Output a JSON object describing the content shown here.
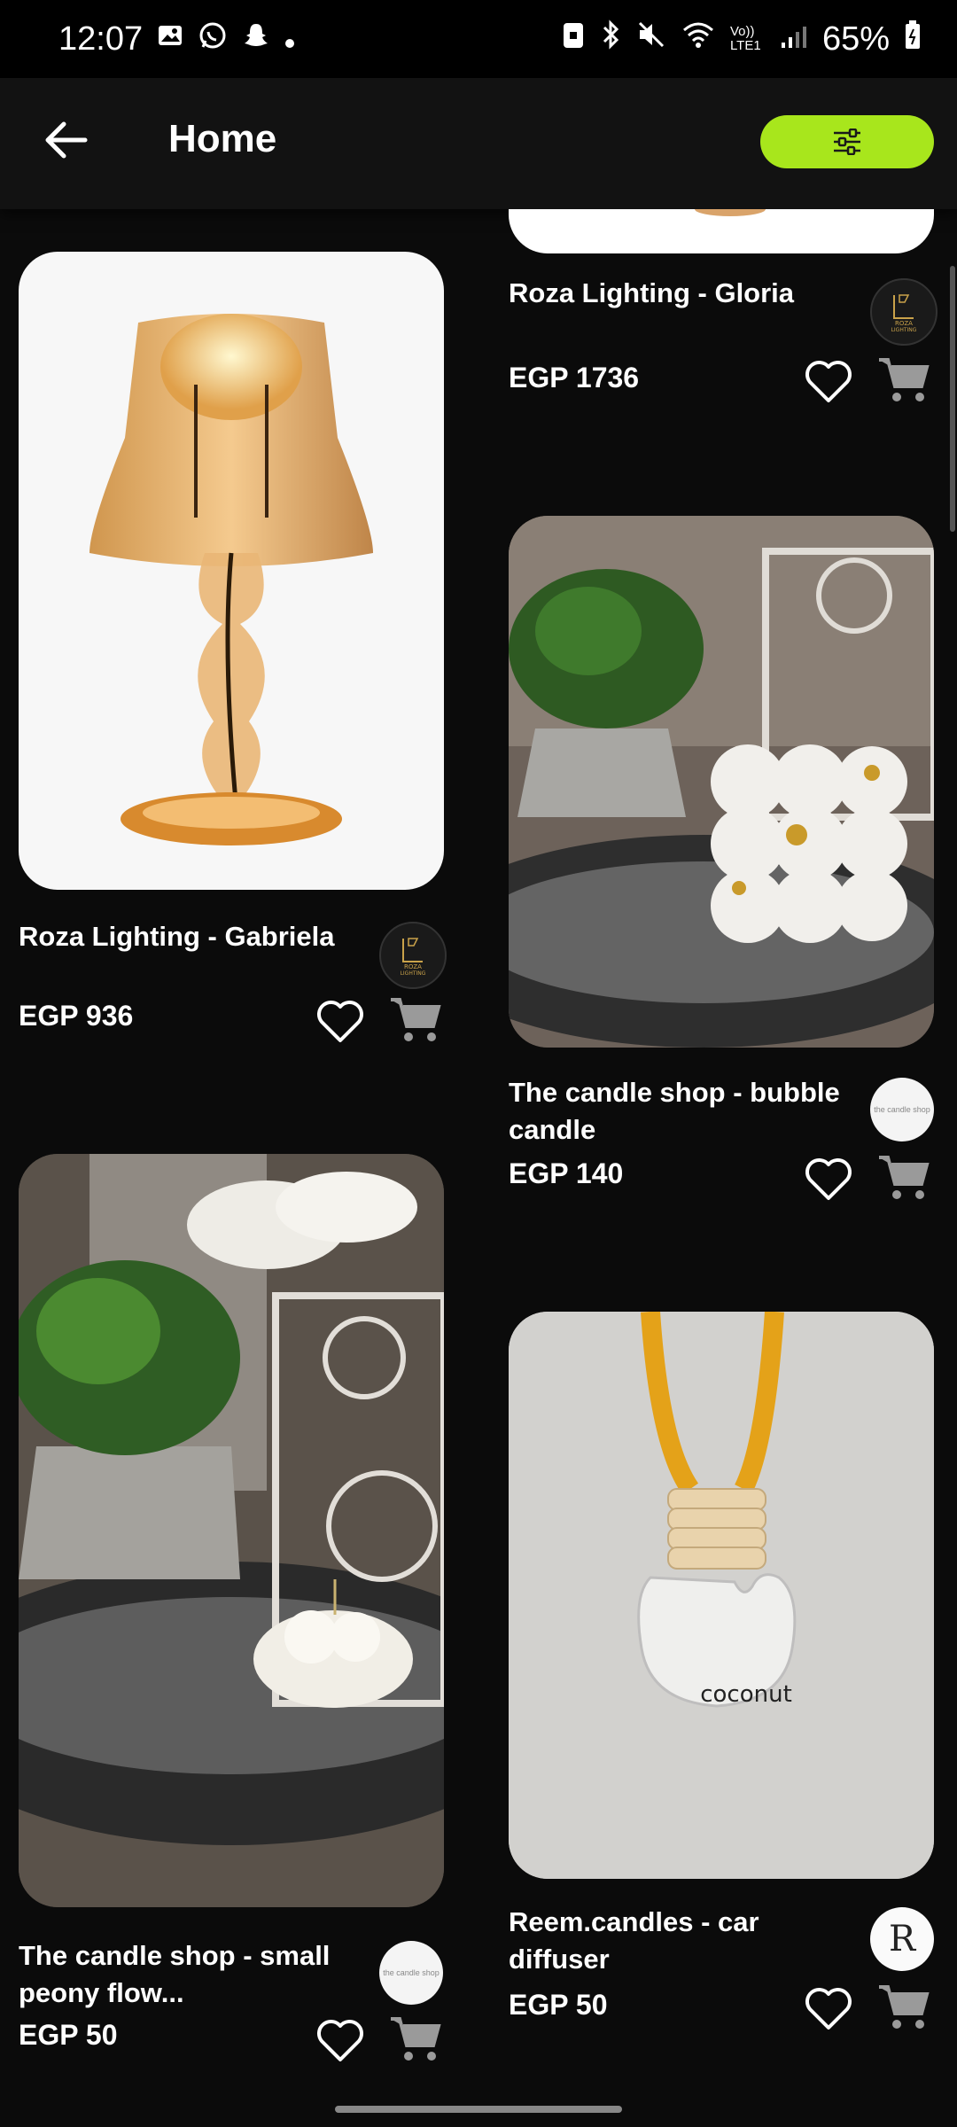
{
  "status": {
    "time": "12:07",
    "battery": "65%",
    "left_icons": [
      "gallery-icon",
      "whatsapp-icon",
      "snapchat-icon",
      "dot-icon"
    ],
    "right_icons": [
      "lock-battery-icon",
      "bluetooth-icon",
      "mute-icon",
      "wifi-icon",
      "volte-icon",
      "signal-icon",
      "battery-icon"
    ],
    "volte_label": "Vo)) LTE1"
  },
  "header": {
    "title": "Home"
  },
  "colors": {
    "accent": "#a8e61c",
    "background": "#0b0b0b",
    "card": "#ffffff"
  },
  "products": [
    {
      "name": "Roza Lighting - Gloria",
      "price": "EGP 1736",
      "seller": "roza-lighting"
    },
    {
      "name": "Roza Lighting - Gabriela",
      "price": "EGP 936",
      "seller": "roza-lighting"
    },
    {
      "name": "The candle shop - bubble candle",
      "price": "EGP 140",
      "seller": "the-candle-shop"
    },
    {
      "name": "The candle shop - small peony flow...",
      "price": "EGP 50",
      "seller": "the-candle-shop"
    },
    {
      "name": "Reem.candles - car diffuser",
      "price": "EGP 50",
      "seller": "reem-candles"
    }
  ],
  "sellers": {
    "roza": {
      "logo_text_1": "ROZA",
      "logo_text_2": "LIGHTING"
    },
    "candle_shop": {
      "logo_text": "the candle shop"
    },
    "reem": {
      "logo_letter": "R"
    }
  },
  "image_labels": {
    "diffuser_label": "coconut"
  }
}
